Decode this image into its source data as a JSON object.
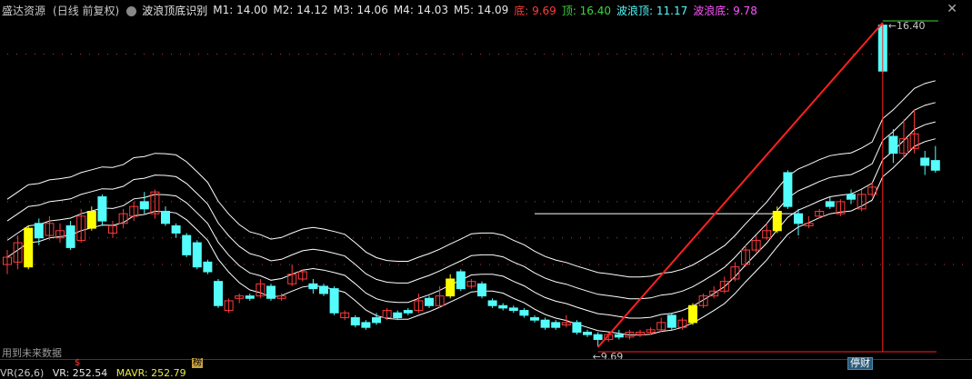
{
  "header": {
    "stock_name": "盛达资源",
    "stock_mode": "(日线 前复权)",
    "indicator_name": "波浪顶底识别",
    "m1": "M1: 14.00",
    "m2": "M2: 14.12",
    "m3": "M3: 14.06",
    "m4": "M4: 14.03",
    "m5": "M5: 14.09",
    "di": "底: 9.69",
    "ding": "顶: 16.40",
    "wave_top": "波浪顶: 11.17",
    "wave_bottom": "波浪底: 9.78",
    "close_icon": "close-icon"
  },
  "annotations": {
    "high_label": "16.40",
    "low_label": "9.69",
    "future_note": "用到未来数据",
    "mark_s": "$",
    "mark_bang": "榜",
    "mark_tingcai": "停财"
  },
  "vr": {
    "label": "VR(26,6)",
    "vr_value": "VR: 252.54",
    "mavr_value": "MAVR: 252.79"
  },
  "colors": {
    "up": "#ff3b3b",
    "down": "#54fcfc",
    "highlight": "#ffff00",
    "band": "#ffffff",
    "trend": "#ff2020",
    "background": "#000000"
  },
  "chart_data": {
    "type": "candlestick",
    "high": 16.4,
    "low": 9.69,
    "candles": [
      {
        "o": 11.4,
        "c": 11.55,
        "h": 11.7,
        "l": 11.2
      },
      {
        "o": 11.45,
        "c": 11.85,
        "h": 12.0,
        "l": 11.3
      },
      {
        "o": 11.35,
        "c": 12.15,
        "h": 12.2,
        "l": 11.3,
        "hl": true
      },
      {
        "o": 12.25,
        "c": 11.95,
        "h": 12.35,
        "l": 11.8
      },
      {
        "o": 12.0,
        "c": 12.25,
        "h": 12.4,
        "l": 11.9
      },
      {
        "o": 11.95,
        "c": 12.1,
        "h": 12.25,
        "l": 11.85
      },
      {
        "o": 12.2,
        "c": 11.75,
        "h": 12.3,
        "l": 11.7
      },
      {
        "o": 11.9,
        "c": 12.4,
        "h": 12.55,
        "l": 11.85
      },
      {
        "o": 12.15,
        "c": 12.5,
        "h": 12.6,
        "l": 12.1,
        "hl": true
      },
      {
        "o": 12.8,
        "c": 12.3,
        "h": 12.85,
        "l": 12.2
      },
      {
        "o": 12.05,
        "c": 12.2,
        "h": 12.3,
        "l": 11.95
      },
      {
        "o": 12.25,
        "c": 12.45,
        "h": 12.55,
        "l": 12.15
      },
      {
        "o": 12.4,
        "c": 12.6,
        "h": 12.7,
        "l": 12.3
      },
      {
        "o": 12.7,
        "c": 12.55,
        "h": 12.9,
        "l": 12.45
      },
      {
        "o": 12.45,
        "c": 12.9,
        "h": 12.95,
        "l": 12.35
      },
      {
        "o": 12.5,
        "c": 12.25,
        "h": 12.6,
        "l": 12.2
      },
      {
        "o": 12.2,
        "c": 12.05,
        "h": 12.25,
        "l": 11.95
      },
      {
        "o": 12.0,
        "c": 11.6,
        "h": 12.05,
        "l": 11.55
      },
      {
        "o": 11.85,
        "c": 11.35,
        "h": 11.9,
        "l": 11.3
      },
      {
        "o": 11.45,
        "c": 11.25,
        "h": 11.5,
        "l": 11.2
      },
      {
        "o": 11.05,
        "c": 10.55,
        "h": 11.1,
        "l": 10.5
      },
      {
        "o": 10.45,
        "c": 10.65,
        "h": 10.7,
        "l": 10.4
      },
      {
        "o": 10.7,
        "c": 10.75,
        "h": 10.8,
        "l": 10.6
      },
      {
        "o": 10.75,
        "c": 10.7,
        "h": 10.8,
        "l": 10.65
      },
      {
        "o": 10.75,
        "c": 11.0,
        "h": 11.1,
        "l": 10.7
      },
      {
        "o": 10.95,
        "c": 10.7,
        "h": 11.0,
        "l": 10.65
      },
      {
        "o": 10.7,
        "c": 10.75,
        "h": 10.8,
        "l": 10.65
      },
      {
        "o": 11.0,
        "c": 11.2,
        "h": 11.4,
        "l": 10.95
      },
      {
        "o": 11.1,
        "c": 11.25,
        "h": 11.3,
        "l": 11.05
      },
      {
        "o": 11.0,
        "c": 10.9,
        "h": 11.1,
        "l": 10.8
      },
      {
        "o": 10.95,
        "c": 10.8,
        "h": 11.0,
        "l": 10.75
      },
      {
        "o": 10.9,
        "c": 10.4,
        "h": 10.95,
        "l": 10.35
      },
      {
        "o": 10.3,
        "c": 10.4,
        "h": 10.45,
        "l": 10.25
      },
      {
        "o": 10.3,
        "c": 10.15,
        "h": 10.35,
        "l": 10.1
      },
      {
        "o": 10.2,
        "c": 10.1,
        "h": 10.25,
        "l": 10.05
      },
      {
        "o": 10.3,
        "c": 10.2,
        "h": 10.4,
        "l": 10.15
      },
      {
        "o": 10.3,
        "c": 10.45,
        "h": 10.5,
        "l": 10.25
      },
      {
        "o": 10.4,
        "c": 10.3,
        "h": 10.45,
        "l": 10.25
      },
      {
        "o": 10.45,
        "c": 10.4,
        "h": 10.5,
        "l": 10.35
      },
      {
        "o": 10.45,
        "c": 10.65,
        "h": 10.8,
        "l": 10.4
      },
      {
        "o": 10.7,
        "c": 10.55,
        "h": 10.75,
        "l": 10.5
      },
      {
        "o": 10.55,
        "c": 10.75,
        "h": 10.95,
        "l": 10.5
      },
      {
        "o": 10.75,
        "c": 11.1,
        "h": 11.2,
        "l": 10.7,
        "hl": true
      },
      {
        "o": 11.25,
        "c": 10.9,
        "h": 11.3,
        "l": 10.85
      },
      {
        "o": 10.95,
        "c": 11.05,
        "h": 11.1,
        "l": 10.9
      },
      {
        "o": 11.0,
        "c": 10.75,
        "h": 11.05,
        "l": 10.7
      },
      {
        "o": 10.65,
        "c": 10.55,
        "h": 10.7,
        "l": 10.5
      },
      {
        "o": 10.55,
        "c": 10.5,
        "h": 10.6,
        "l": 10.45
      },
      {
        "o": 10.5,
        "c": 10.45,
        "h": 10.55,
        "l": 10.4
      },
      {
        "o": 10.45,
        "c": 10.35,
        "h": 10.5,
        "l": 10.3
      },
      {
        "o": 10.3,
        "c": 10.25,
        "h": 10.35,
        "l": 10.2
      },
      {
        "o": 10.25,
        "c": 10.1,
        "h": 10.3,
        "l": 10.05
      },
      {
        "o": 10.2,
        "c": 10.1,
        "h": 10.25,
        "l": 10.05
      },
      {
        "o": 10.15,
        "c": 10.2,
        "h": 10.35,
        "l": 10.1
      },
      {
        "o": 10.2,
        "c": 10.0,
        "h": 10.25,
        "l": 9.95
      },
      {
        "o": 10.0,
        "c": 9.95,
        "h": 10.05,
        "l": 9.9
      },
      {
        "o": 9.95,
        "c": 9.85,
        "h": 10.0,
        "l": 9.69
      },
      {
        "o": 9.85,
        "c": 9.95,
        "h": 10.0,
        "l": 9.8
      },
      {
        "o": 9.95,
        "c": 9.9,
        "h": 10.05,
        "l": 9.85
      },
      {
        "o": 9.9,
        "c": 10.0,
        "h": 10.05,
        "l": 9.85
      },
      {
        "o": 9.95,
        "c": 10.0,
        "h": 10.05,
        "l": 9.9
      },
      {
        "o": 10.0,
        "c": 10.05,
        "h": 10.1,
        "l": 9.95
      },
      {
        "o": 10.05,
        "c": 10.2,
        "h": 10.3,
        "l": 10.0
      },
      {
        "o": 10.35,
        "c": 10.1,
        "h": 10.4,
        "l": 10.05
      },
      {
        "o": 10.1,
        "c": 10.25,
        "h": 10.3,
        "l": 10.05
      },
      {
        "o": 10.2,
        "c": 10.55,
        "h": 10.6,
        "l": 10.15,
        "hl": true
      },
      {
        "o": 10.55,
        "c": 10.75,
        "h": 10.8,
        "l": 10.5
      },
      {
        "o": 10.75,
        "c": 10.85,
        "h": 10.95,
        "l": 10.7
      },
      {
        "o": 10.85,
        "c": 11.05,
        "h": 11.15,
        "l": 10.8
      },
      {
        "o": 11.1,
        "c": 11.35,
        "h": 11.45,
        "l": 11.05
      },
      {
        "o": 11.4,
        "c": 11.7,
        "h": 11.8,
        "l": 11.35
      },
      {
        "o": 11.7,
        "c": 11.9,
        "h": 12.0,
        "l": 11.65
      },
      {
        "o": 11.95,
        "c": 12.1,
        "h": 12.25,
        "l": 11.9
      },
      {
        "o": 12.1,
        "c": 12.5,
        "h": 12.6,
        "l": 12.05,
        "hl": true
      },
      {
        "o": 13.3,
        "c": 12.6,
        "h": 13.35,
        "l": 12.55
      },
      {
        "o": 12.45,
        "c": 12.25,
        "h": 12.55,
        "l": 12.0
      },
      {
        "o": 12.2,
        "c": 12.25,
        "h": 12.4,
        "l": 12.15
      },
      {
        "o": 12.4,
        "c": 12.5,
        "h": 12.55,
        "l": 12.35
      },
      {
        "o": 12.7,
        "c": 12.6,
        "h": 12.8,
        "l": 12.55
      },
      {
        "o": 12.45,
        "c": 12.7,
        "h": 12.75,
        "l": 12.4
      },
      {
        "o": 12.85,
        "c": 12.75,
        "h": 12.95,
        "l": 12.65
      },
      {
        "o": 12.55,
        "c": 12.85,
        "h": 12.95,
        "l": 12.5
      },
      {
        "o": 12.85,
        "c": 13.0,
        "h": 13.1,
        "l": 12.8
      },
      {
        "o": 16.35,
        "c": 15.4,
        "h": 16.4,
        "l": 15.35
      },
      {
        "o": 14.05,
        "c": 13.7,
        "h": 14.2,
        "l": 13.5
      },
      {
        "o": 13.7,
        "c": 14.0,
        "h": 14.4,
        "l": 13.6
      },
      {
        "o": 13.8,
        "c": 14.1,
        "h": 14.6,
        "l": 13.7
      },
      {
        "o": 13.6,
        "c": 13.45,
        "h": 13.75,
        "l": 13.25
      },
      {
        "o": 13.55,
        "c": 13.35,
        "h": 13.85,
        "l": 13.3
      }
    ]
  }
}
